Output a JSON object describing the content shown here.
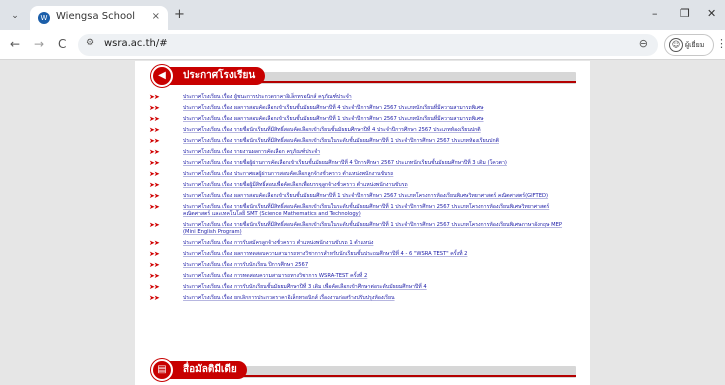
{
  "browser": {
    "tab": {
      "title": "Wiengsa School",
      "close": "×"
    },
    "new_tab": "+",
    "window_controls": {
      "minimize": "–",
      "restore": "❐",
      "close": "✕"
    },
    "nav": {
      "back": "←",
      "forward": "→",
      "reload": "C"
    },
    "url": "wsra.ac.th/#",
    "zoom_icon": "⊖",
    "profile": {
      "name": "ผู้เยี่ยม"
    },
    "menu": "⋮"
  },
  "sections": {
    "announcements": {
      "title": "ประกาศโรงเรียน",
      "icon": "megaphone-icon",
      "items": [
        "ประกาศโรงเรียน เรื่อง ผู้ชนะการประกวดราคาอิเล็กทรอนิกส์ ครุภัณฑ์ประจำ",
        "ประกาศโรงเรียน เรื่อง ผลการสอบคัดเลือกเข้าเรียนชั้นมัธยมศึกษาปีที่ 4 ประจำปีการศึกษา 2567 ประเภทนักเรียนที่มีความสามารถพิเศษ",
        "ประกาศโรงเรียน เรื่อง ผลการสอบคัดเลือกเข้าเรียนชั้นมัธยมศึกษาปีที่ 1 ประจำปีการศึกษา 2567 ประเภทนักเรียนที่มีความสามารถพิเศษ",
        "ประกาศโรงเรียน เรื่อง รายชื่อนักเรียนที่มีสิทธิ์สอบคัดเลือกเข้าเรียนชั้นมัธยมศึกษาปีที่ 4 ประจำปีการศึกษา 2567 ประเภทห้องเรียนปกติ",
        "ประกาศโรงเรียน เรื่อง รายชื่อนักเรียนที่มีสิทธิ์สอบคัดเลือกเข้าเรียนในระดับชั้นมัธยมศึกษาปีที่ 1 ประจำปีการศึกษา 2567 ประเภทห้องเรียนปกติ",
        "ประกาศโรงเรียน เรื่อง รายงานผลการคัดเลือก ครุภัณฑ์ประจำ",
        "ประกาศโรงเรียน เรื่อง รายชื่อผู้ผ่านการคัดเลือกเข้าเรียนชั้นมัธยมศึกษาปีที่ 4 ปีการศึกษา 2567 ประเภทนักเรียนชั้นมัธยมศึกษาปีที่ 3 เดิม (โควตา)",
        "ประกาศโรงเรียน เรื่อง ประกาศผลผู้ผ่านการสอบคัดเลือกลูกจ้างชั่วคราว ตำแหน่งพนักงานขับรถ",
        "ประกาศโรงเรียน เรื่อง รายชื่อผู้มีสิทธิ์สอบเพื่อคัดเลือกเพื่อบรรจุลูกจ้างชั่วคราว ตำแหน่งพนักงานขับรถ",
        "ประกาศโรงเรียน เรื่อง ผลการสอบคัดเลือกเข้าเรียนชั้นมัธยมศึกษาปีที่ 1 ประจำปีการศึกษา 2567 ประเภทโครงการห้องเรียนพิเศษวิทยาศาสตร์ คณิตศาสตร์(GIFTED)",
        "ประกาศโรงเรียน เรื่อง รายชื่อนักเรียนที่มีสิทธิ์สอบคัดเลือกเข้าเรียนในระดับชั้นมัธยมศึกษาปีที่ 1 ประจำปีการศึกษา 2567 ประเภทโครงการห้องเรียนพิเศษวิทยาศาสตร์ คณิตศาสตร์ และเทคโนโลยี SMT (Science Mathematics and Technology)",
        "ประกาศโรงเรียน เรื่อง รายชื่อนักเรียนที่มีสิทธิ์สอบคัดเลือกเข้าเรียนในระดับชั้นมัธยมศึกษาปีที่ 1 ประจำปีการศึกษา 2567 ประเภทโครงการห้องเรียนพิเศษภาษาอังกฤษ MEP (Mini English Program)",
        "ประกาศโรงเรียน เรื่อง การรับสมัครลูกจ้างชั่วคราว ตำแหน่งพนักงานขับรถ 1 ตำแหน่ง",
        "ประกาศโรงเรียน เรื่อง ผลการทดสอบความสามารถทางวิชาการสำหรับนักเรียนชั้นประถมศึกษาปีที่ 4 - 6 \"WSRA TEST\" ครั้งที่ 2",
        "ประกาศโรงเรียน เรื่อง การรับนักเรียน ปีการศึกษา 2567",
        "ประกาศโรงเรียน เรื่อง การทดสอบความสามารถทางวิชาการ WSRA-TEST ครั้งที่ 2",
        "ประกาศโรงเรียน เรื่อง การรับนักเรียนชั้นมัธยมศึกษาปีที่ 3 เดิม เพื่อคัดเลือกเข้าศึกษาต่อระดับมัธยมศึกษาปีที่ 4",
        "ประกาศโรงเรียน เรื่อง ยกเลิกการประกวดราคาอิเล็กทรอนิกส์ เรื่องงานก่อสร้างปรับปรุงห้องเรียน"
      ]
    },
    "media": {
      "title": "สื่อมัลติมีเดีย",
      "icon": "film-icon"
    }
  },
  "colors": {
    "accent": "#c80000",
    "link": "#1a1aa6",
    "arrow": "#d00000"
  }
}
